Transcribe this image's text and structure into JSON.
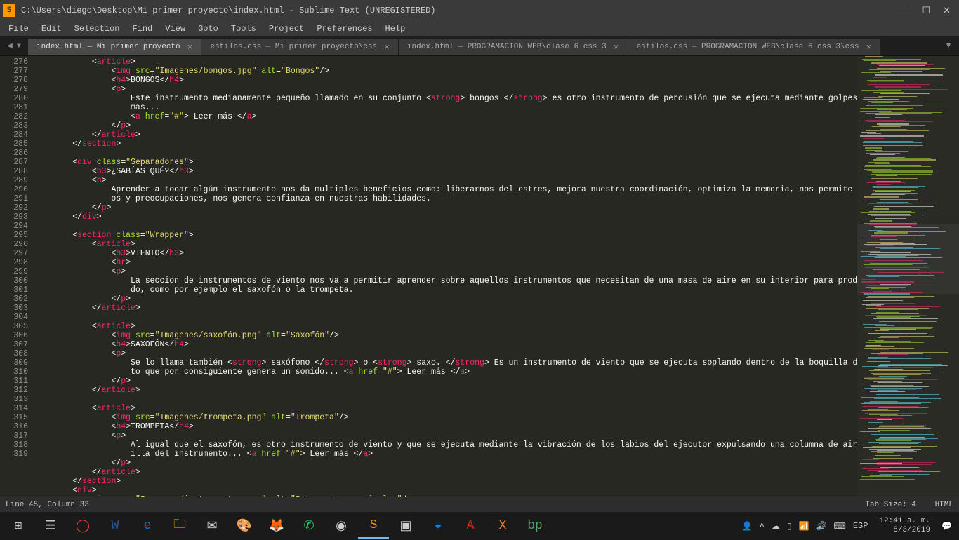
{
  "window": {
    "title": "C:\\Users\\diego\\Desktop\\Mi primer proyecto\\index.html - Sublime Text (UNREGISTERED)"
  },
  "menu": {
    "items": [
      "File",
      "Edit",
      "Selection",
      "Find",
      "View",
      "Goto",
      "Tools",
      "Project",
      "Preferences",
      "Help"
    ]
  },
  "tabs": [
    {
      "label": "index.html — Mi primer proyecto",
      "active": true
    },
    {
      "label": "estilos.css — Mi primer proyecto\\css",
      "active": false
    },
    {
      "label": "index.html — PROGRAMACION  WEB\\clase 6 css 3",
      "active": false
    },
    {
      "label": "estilos.css — PROGRAMACION  WEB\\clase 6 css 3\\css",
      "active": false
    }
  ],
  "gutter": {
    "start": 276,
    "end": 319
  },
  "code_lines": [
    {
      "i": 12,
      "h": [
        [
          "pun",
          "<"
        ],
        [
          "tag",
          "article"
        ],
        [
          "pun",
          ">"
        ]
      ]
    },
    {
      "i": 16,
      "h": [
        [
          "pun",
          "<"
        ],
        [
          "tag",
          "img"
        ],
        [
          "text",
          " "
        ],
        [
          "attr",
          "src"
        ],
        [
          "pun",
          "="
        ],
        [
          "str",
          "\"Imagenes/bongos.jpg\""
        ],
        [
          "text",
          " "
        ],
        [
          "attr",
          "alt"
        ],
        [
          "pun",
          "="
        ],
        [
          "str",
          "\"Bongos\""
        ],
        [
          "pun",
          "/>"
        ]
      ]
    },
    {
      "i": 16,
      "h": [
        [
          "pun",
          "<"
        ],
        [
          "tag",
          "h4"
        ],
        [
          "pun",
          ">"
        ],
        [
          "text",
          "BONGOS"
        ],
        [
          "pun",
          "</"
        ],
        [
          "tag",
          "h4"
        ],
        [
          "pun",
          ">"
        ]
      ]
    },
    {
      "i": 16,
      "h": [
        [
          "pun",
          "<"
        ],
        [
          "tag",
          "p"
        ],
        [
          "pun",
          ">"
        ]
      ]
    },
    {
      "i": 20,
      "h": [
        [
          "text",
          "Este instrumento medianamente pequeño llamado en su conjunto "
        ],
        [
          "pun",
          "<"
        ],
        [
          "tag",
          "strong"
        ],
        [
          "pun",
          ">"
        ],
        [
          "text",
          " bongos "
        ],
        [
          "pun",
          "</"
        ],
        [
          "tag",
          "strong"
        ],
        [
          "pun",
          ">"
        ],
        [
          "text",
          " es otro instrumento de percusión que se ejecuta mediante golpes con las palmas..."
        ]
      ]
    },
    {
      "i": 20,
      "h": [
        [
          "pun",
          "<"
        ],
        [
          "tag",
          "a"
        ],
        [
          "text",
          " "
        ],
        [
          "attr",
          "href"
        ],
        [
          "pun",
          "="
        ],
        [
          "str",
          "\"#\""
        ],
        [
          "pun",
          ">"
        ],
        [
          "text",
          " Leer más "
        ],
        [
          "pun",
          "</"
        ],
        [
          "tag",
          "a"
        ],
        [
          "pun",
          ">"
        ]
      ]
    },
    {
      "i": 16,
      "h": [
        [
          "pun",
          "</"
        ],
        [
          "tag",
          "p"
        ],
        [
          "pun",
          ">"
        ]
      ]
    },
    {
      "i": 12,
      "h": [
        [
          "pun",
          "</"
        ],
        [
          "tag",
          "article"
        ],
        [
          "pun",
          ">"
        ]
      ]
    },
    {
      "i": 8,
      "h": [
        [
          "pun",
          "</"
        ],
        [
          "tag",
          "section"
        ],
        [
          "pun",
          ">"
        ]
      ]
    },
    {
      "i": 0,
      "h": []
    },
    {
      "i": 8,
      "h": [
        [
          "pun",
          "<"
        ],
        [
          "tag",
          "div"
        ],
        [
          "text",
          " "
        ],
        [
          "attr",
          "class"
        ],
        [
          "pun",
          "="
        ],
        [
          "str",
          "\"Separadores\""
        ],
        [
          "pun",
          ">"
        ]
      ]
    },
    {
      "i": 12,
      "h": [
        [
          "pun",
          "<"
        ],
        [
          "tag",
          "h3"
        ],
        [
          "pun",
          ">"
        ],
        [
          "text",
          "¿SABÍAS QUÉ?"
        ],
        [
          "pun",
          "</"
        ],
        [
          "tag",
          "h3"
        ],
        [
          "pun",
          ">"
        ]
      ]
    },
    {
      "i": 12,
      "h": [
        [
          "pun",
          "<"
        ],
        [
          "tag",
          "p"
        ],
        [
          "pun",
          ">"
        ]
      ]
    },
    {
      "i": 16,
      "h": [
        [
          "text",
          "Aprender a tocar algún instrumento nos da multiples beneficios como: liberarnos del estres, mejora nuestra coordinación, optimiza la memoria, nos permite liberar miedos y preocupaciones, nos genera confianza en nuestras habilidades."
        ]
      ]
    },
    {
      "i": 12,
      "h": [
        [
          "pun",
          "</"
        ],
        [
          "tag",
          "p"
        ],
        [
          "pun",
          ">"
        ]
      ]
    },
    {
      "i": 8,
      "h": [
        [
          "pun",
          "</"
        ],
        [
          "tag",
          "div"
        ],
        [
          "pun",
          ">"
        ]
      ]
    },
    {
      "i": 0,
      "h": []
    },
    {
      "i": 8,
      "h": [
        [
          "pun",
          "<"
        ],
        [
          "tag",
          "section"
        ],
        [
          "text",
          " "
        ],
        [
          "attr",
          "class"
        ],
        [
          "pun",
          "="
        ],
        [
          "str",
          "\"Wrapper\""
        ],
        [
          "pun",
          ">"
        ]
      ]
    },
    {
      "i": 12,
      "h": [
        [
          "pun",
          "<"
        ],
        [
          "tag",
          "article"
        ],
        [
          "pun",
          ">"
        ]
      ]
    },
    {
      "i": 16,
      "h": [
        [
          "pun",
          "<"
        ],
        [
          "tag",
          "h3"
        ],
        [
          "pun",
          ">"
        ],
        [
          "text",
          "VIENTO"
        ],
        [
          "pun",
          "</"
        ],
        [
          "tag",
          "h3"
        ],
        [
          "pun",
          ">"
        ]
      ]
    },
    {
      "i": 16,
      "h": [
        [
          "pun",
          "<"
        ],
        [
          "tag",
          "hr"
        ],
        [
          "pun",
          ">"
        ]
      ]
    },
    {
      "i": 16,
      "h": [
        [
          "pun",
          "<"
        ],
        [
          "tag",
          "p"
        ],
        [
          "pun",
          ">"
        ]
      ]
    },
    {
      "i": 20,
      "h": [
        [
          "text",
          "La seccion de instrumentos de viento nos va a permitir aprender sobre aquellos instrumentos que necesitan de una masa de aire en su interior para producir un sonido, como por ejemplo el saxofón o la trompeta."
        ]
      ]
    },
    {
      "i": 16,
      "h": [
        [
          "pun",
          "</"
        ],
        [
          "tag",
          "p"
        ],
        [
          "pun",
          ">"
        ]
      ]
    },
    {
      "i": 12,
      "h": [
        [
          "pun",
          "</"
        ],
        [
          "tag",
          "article"
        ],
        [
          "pun",
          ">"
        ]
      ]
    },
    {
      "i": 0,
      "h": []
    },
    {
      "i": 12,
      "h": [
        [
          "pun",
          "<"
        ],
        [
          "tag",
          "article"
        ],
        [
          "pun",
          ">"
        ]
      ]
    },
    {
      "i": 16,
      "h": [
        [
          "pun",
          "<"
        ],
        [
          "tag",
          "img"
        ],
        [
          "text",
          " "
        ],
        [
          "attr",
          "src"
        ],
        [
          "pun",
          "="
        ],
        [
          "str",
          "\"Imagenes/saxofón.png\""
        ],
        [
          "text",
          " "
        ],
        [
          "attr",
          "alt"
        ],
        [
          "pun",
          "="
        ],
        [
          "str",
          "\"Saxofón\""
        ],
        [
          "pun",
          "/>"
        ]
      ]
    },
    {
      "i": 16,
      "h": [
        [
          "pun",
          "<"
        ],
        [
          "tag",
          "h4"
        ],
        [
          "pun",
          ">"
        ],
        [
          "text",
          "SAXOFÓN"
        ],
        [
          "pun",
          "</"
        ],
        [
          "tag",
          "h4"
        ],
        [
          "pun",
          ">"
        ]
      ]
    },
    {
      "i": 16,
      "h": [
        [
          "pun",
          "<"
        ],
        [
          "tag",
          "p"
        ],
        [
          "pun",
          ">"
        ]
      ]
    },
    {
      "i": 20,
      "h": [
        [
          "text",
          "Se lo llama también "
        ],
        [
          "pun",
          "<"
        ],
        [
          "tag",
          "strong"
        ],
        [
          "pun",
          ">"
        ],
        [
          "text",
          " saxófono "
        ],
        [
          "pun",
          "</"
        ],
        [
          "tag",
          "strong"
        ],
        [
          "pun",
          ">"
        ],
        [
          "text",
          " o "
        ],
        [
          "pun",
          "<"
        ],
        [
          "tag",
          "strong"
        ],
        [
          "pun",
          ">"
        ],
        [
          "text",
          " saxo. "
        ],
        [
          "pun",
          "</"
        ],
        [
          "tag",
          "strong"
        ],
        [
          "pun",
          ">"
        ],
        [
          "text",
          " Es un instrumento de viento que se ejecuta soplando dentro de la boquilla del instrumento que por consiguiente genera un sonido... "
        ],
        [
          "pun",
          "<"
        ],
        [
          "tag",
          "a"
        ],
        [
          "text",
          " "
        ],
        [
          "attr",
          "href"
        ],
        [
          "pun",
          "="
        ],
        [
          "str",
          "\"#\""
        ],
        [
          "pun",
          ">"
        ],
        [
          "text",
          " Leer más "
        ],
        [
          "pun",
          "</"
        ],
        [
          "tag",
          "a"
        ],
        [
          "pun",
          ">"
        ]
      ]
    },
    {
      "i": 16,
      "h": [
        [
          "pun",
          "</"
        ],
        [
          "tag",
          "p"
        ],
        [
          "pun",
          ">"
        ]
      ]
    },
    {
      "i": 12,
      "h": [
        [
          "pun",
          "</"
        ],
        [
          "tag",
          "article"
        ],
        [
          "pun",
          ">"
        ]
      ]
    },
    {
      "i": 0,
      "h": []
    },
    {
      "i": 12,
      "h": [
        [
          "pun",
          "<"
        ],
        [
          "tag",
          "article"
        ],
        [
          "pun",
          ">"
        ]
      ]
    },
    {
      "i": 16,
      "h": [
        [
          "pun",
          "<"
        ],
        [
          "tag",
          "img"
        ],
        [
          "text",
          " "
        ],
        [
          "attr",
          "src"
        ],
        [
          "pun",
          "="
        ],
        [
          "str",
          "\"Imagenes/trompeta.png\""
        ],
        [
          "text",
          " "
        ],
        [
          "attr",
          "alt"
        ],
        [
          "pun",
          "="
        ],
        [
          "str",
          "\"Trompeta\""
        ],
        [
          "pun",
          "/>"
        ]
      ]
    },
    {
      "i": 16,
      "h": [
        [
          "pun",
          "<"
        ],
        [
          "tag",
          "h4"
        ],
        [
          "pun",
          ">"
        ],
        [
          "text",
          "TROMPETA"
        ],
        [
          "pun",
          "</"
        ],
        [
          "tag",
          "h4"
        ],
        [
          "pun",
          ">"
        ]
      ]
    },
    {
      "i": 16,
      "h": [
        [
          "pun",
          "<"
        ],
        [
          "tag",
          "p"
        ],
        [
          "pun",
          ">"
        ]
      ]
    },
    {
      "i": 20,
      "h": [
        [
          "text",
          "Al igual que el saxofón, es otro instrumento de viento y que se ejecuta mediante la vibración de los labios del ejecutor expulsando una columna de aire en la boquilla del instrumento... "
        ],
        [
          "pun",
          "<"
        ],
        [
          "tag",
          "a"
        ],
        [
          "text",
          " "
        ],
        [
          "attr",
          "href"
        ],
        [
          "pun",
          "="
        ],
        [
          "str",
          "\"#\""
        ],
        [
          "pun",
          ">"
        ],
        [
          "text",
          " Leer más "
        ],
        [
          "pun",
          "</"
        ],
        [
          "tag",
          "a"
        ],
        [
          "pun",
          ">"
        ]
      ]
    },
    {
      "i": 16,
      "h": [
        [
          "pun",
          "</"
        ],
        [
          "tag",
          "p"
        ],
        [
          "pun",
          ">"
        ]
      ]
    },
    {
      "i": 12,
      "h": [
        [
          "pun",
          "</"
        ],
        [
          "tag",
          "article"
        ],
        [
          "pun",
          ">"
        ]
      ]
    },
    {
      "i": 8,
      "h": [
        [
          "pun",
          "</"
        ],
        [
          "tag",
          "section"
        ],
        [
          "pun",
          ">"
        ]
      ]
    },
    {
      "i": 8,
      "h": [
        [
          "pun",
          "<"
        ],
        [
          "tag",
          "div"
        ],
        [
          "pun",
          ">"
        ]
      ]
    },
    {
      "i": 12,
      "h": [
        [
          "pun",
          "<"
        ],
        [
          "tag",
          "img"
        ],
        [
          "text",
          " "
        ],
        [
          "attr",
          "src"
        ],
        [
          "pun",
          "="
        ],
        [
          "str",
          "\"Imagenes/instrumentos.png\""
        ],
        [
          "text",
          " "
        ],
        [
          "attr",
          "alt"
        ],
        [
          "pun",
          "="
        ],
        [
          "str",
          "\"Intrumentos musicales\""
        ],
        [
          "pun",
          "/>"
        ]
      ]
    }
  ],
  "status": {
    "left": "Line 45, Column 33",
    "tab_size": "Tab Size: 4",
    "syntax": "HTML"
  },
  "taskbar": {
    "lang": "ESP",
    "time": "12:41 a. m.",
    "date": "8/3/2019"
  }
}
